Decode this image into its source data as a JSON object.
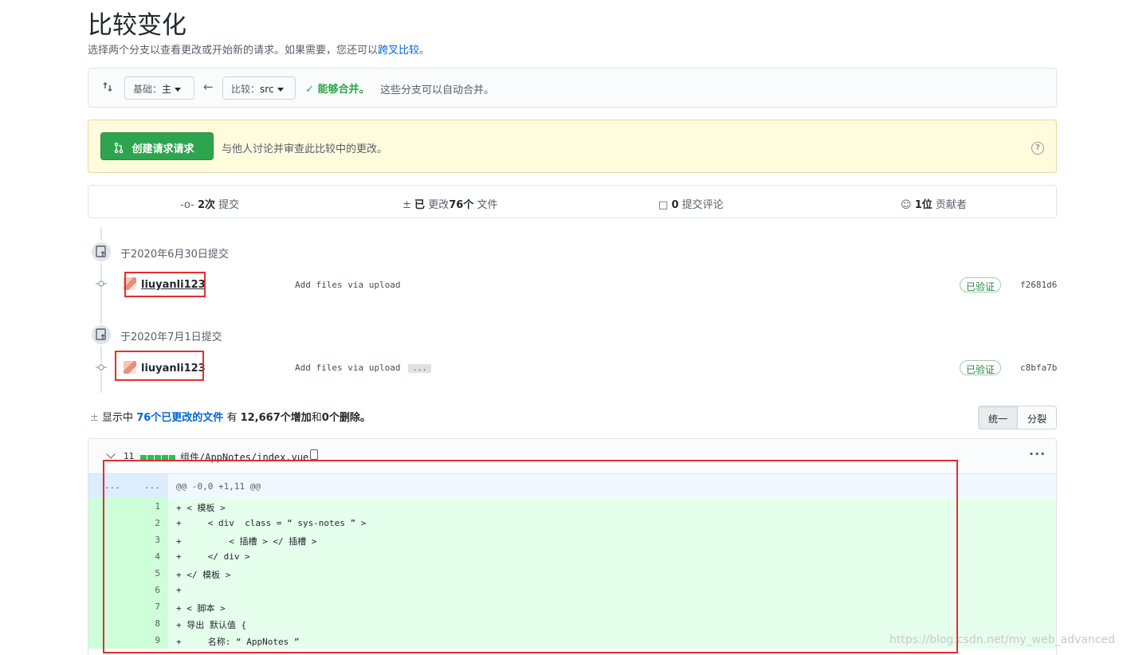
{
  "page": {
    "title": "比较变化",
    "subtitle_text": "选择两个分支以查看更改或开始新的请求。如果需要，您还可以",
    "subtitle_link": "跨叉比较",
    "subtitle_end": "。"
  },
  "range": {
    "base_label": "基础：",
    "base_value": "主",
    "compare_label": "比较：",
    "compare_value": "src",
    "merge_status": "能够合并。",
    "merge_desc": "这些分支可以自动合并。"
  },
  "pull_request": {
    "button_label": "创建请求请求",
    "description": "与他人讨论并审查此比较中的更改。"
  },
  "stats": {
    "commits_num": "2次",
    "commits_label": "提交",
    "files_prefix": "已",
    "files_mid": "更改",
    "files_num": "76个",
    "files_label": "文件",
    "comments_num": "0",
    "comments_label": "提交评论",
    "contributors_num": "1位",
    "contributors_label": "贡献者"
  },
  "commits": [
    {
      "date_label": "于2020年6月30日提交",
      "author": "liuyanli123",
      "message": "Add files via upload",
      "has_ellipsis": false,
      "verified": "已验证",
      "sha": "f2681d6"
    },
    {
      "date_label": "于2020年7月1日提交",
      "author": "liuyanli123",
      "message": "Add files via upload",
      "ellipsis": "...",
      "verified": "已验证",
      "sha": "c8bfa7b"
    }
  ],
  "toc": {
    "prefix": "显示中",
    "link": "76个已更改的文件",
    "mid1": "有",
    "additions": "12,667个增加",
    "mid2": "和",
    "deletions": "0个删除。"
  },
  "view_toggle": {
    "unified": "统一",
    "split": "分裂"
  },
  "file": {
    "change_count": "11",
    "path": "组件/AppNotes/index.vue",
    "hunk_left": "...",
    "hunk_right": "...",
    "hunk_header": "@@ -0,0 +1,11 @@",
    "lines": [
      {
        "num": "1",
        "code": "+ < 模板 >"
      },
      {
        "num": "2",
        "code": "+     < div  class = “ sys-notes ” >"
      },
      {
        "num": "3",
        "code": "+         < 插槽 > </ 插槽 >"
      },
      {
        "num": "4",
        "code": "+     </ div >"
      },
      {
        "num": "5",
        "code": "+ </ 模板 >"
      },
      {
        "num": "6",
        "code": "+"
      },
      {
        "num": "7",
        "code": "+ < 脚本 >"
      },
      {
        "num": "8",
        "code": "+ 导出 默认值 {"
      },
      {
        "num": "9",
        "code": "+     名称: “ AppNotes ”"
      }
    ]
  },
  "watermark": "https://blog.csdn.net/my_web_advanced",
  "colors": {
    "accent_link": "#0366d6",
    "success": "#28a745",
    "annotation_red": "#e82c2c",
    "diff_add_bg": "#e6ffed"
  }
}
